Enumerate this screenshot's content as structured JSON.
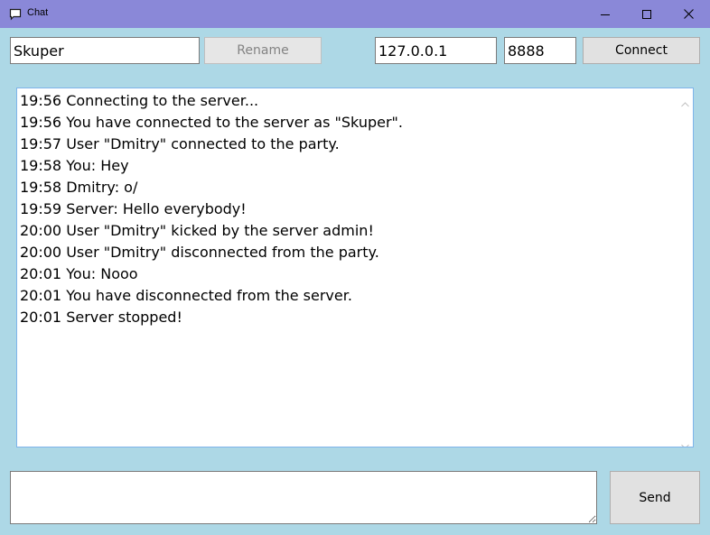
{
  "window": {
    "title": "Chat",
    "icon": "chat-bubble-icon",
    "minimize_icon": "minimize-icon",
    "maximize_icon": "maximize-icon",
    "close_icon": "close-icon",
    "titlebar_color": "#8a88d8",
    "background_color": "#add8e6"
  },
  "toolbar": {
    "name_value": "Skuper",
    "rename_label": "Rename",
    "ip_value": "127.0.0.1",
    "port_value": "8888",
    "connect_label": "Connect"
  },
  "log": {
    "lines": [
      "19:56 Connecting to the server...",
      "19:56 You have connected to the server as \"Skuper\".",
      "19:57 User \"Dmitry\" connected to the party.",
      "19:58 You: Hey",
      "19:58 Dmitry: o/",
      "19:59 Server: Hello everybody!",
      "20:00 User \"Dmitry\" kicked by the server admin!",
      "20:00 User \"Dmitry\" disconnected from the party.",
      "20:01 You: Nooo",
      "20:01 You have disconnected from the server.",
      "20:01 Server stopped!"
    ]
  },
  "composer": {
    "message_value": "",
    "send_label": "Send"
  }
}
